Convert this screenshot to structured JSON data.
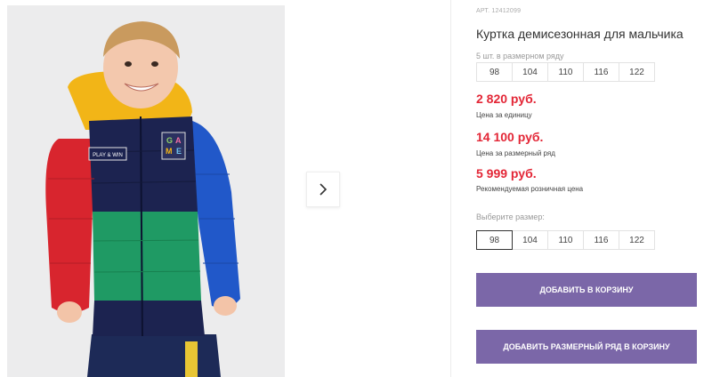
{
  "product": {
    "article": "АРТ. 12412099",
    "title": "Куртка демисезонная для мальчика",
    "pack_label": "5 шт. в размерном ряду",
    "pack_sizes": [
      "98",
      "104",
      "110",
      "116",
      "122"
    ]
  },
  "prices": {
    "unit_price": "2 820 руб.",
    "unit_label": "Цена за единицу",
    "pack_price": "14 100 руб.",
    "pack_label": "Цена за размерный ряд",
    "retail_price": "5 999 руб.",
    "retail_label": "Рекомендуемая розничная цена"
  },
  "size_picker": {
    "label": "Выберите размер:",
    "options": [
      "98",
      "104",
      "110",
      "116",
      "122"
    ],
    "selected": "98"
  },
  "actions": {
    "add_to_cart": "ДОБАВИТЬ В КОРЗИНУ",
    "add_pack_to_cart": "ДОБАВИТЬ РАЗМЕРНЫЙ РЯД В КОРЗИНУ"
  },
  "jacket_print": {
    "chest_patch": "PLAY & WIN",
    "badge_letters": [
      "G",
      "A",
      "M",
      "E"
    ]
  },
  "colors": {
    "price": "#e32636",
    "button": "#7b67a8"
  },
  "icons": {
    "next": "chevron-right-icon"
  }
}
